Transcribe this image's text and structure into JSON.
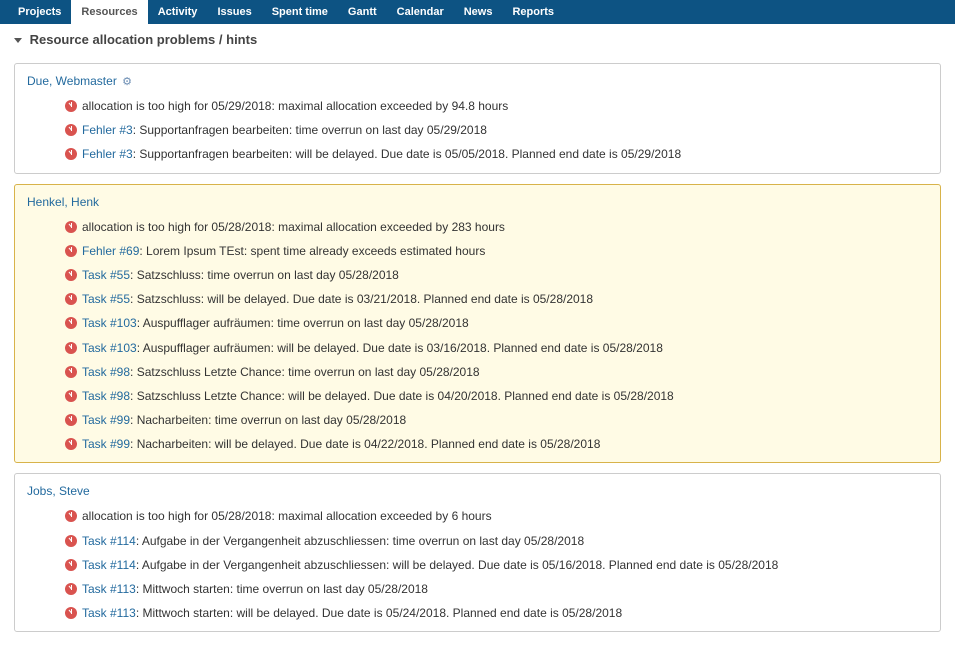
{
  "nav": [
    {
      "label": "Projects",
      "active": false
    },
    {
      "label": "Resources",
      "active": true
    },
    {
      "label": "Activity",
      "active": false
    },
    {
      "label": "Issues",
      "active": false
    },
    {
      "label": "Spent time",
      "active": false
    },
    {
      "label": "Gantt",
      "active": false
    },
    {
      "label": "Calendar",
      "active": false
    },
    {
      "label": "News",
      "active": false
    },
    {
      "label": "Reports",
      "active": false
    }
  ],
  "section_title": "Resource allocation problems / hints",
  "people": [
    {
      "name": "Due, Webmaster",
      "gear": true,
      "highlighted": false,
      "items": [
        {
          "link": "",
          "msg": "allocation is too high for 05/29/2018: maximal allocation exceeded by 94.8 hours"
        },
        {
          "link": "Fehler #3",
          "msg": "Supportanfragen bearbeiten: time overrun on last day 05/29/2018"
        },
        {
          "link": "Fehler #3",
          "msg": "Supportanfragen bearbeiten: will be delayed. Due date is 05/05/2018. Planned end date is 05/29/2018"
        }
      ]
    },
    {
      "name": "Henkel, Henk",
      "gear": false,
      "highlighted": true,
      "items": [
        {
          "link": "",
          "msg": "allocation is too high for 05/28/2018: maximal allocation exceeded by 283 hours"
        },
        {
          "link": "Fehler #69",
          "msg": "Lorem Ipsum TEst: spent time already exceeds estimated hours"
        },
        {
          "link": "Task #55",
          "msg": "Satzschluss: time overrun on last day 05/28/2018"
        },
        {
          "link": "Task #55",
          "msg": "Satzschluss: will be delayed. Due date is 03/21/2018. Planned end date is 05/28/2018"
        },
        {
          "link": "Task #103",
          "msg": "Auspufflager aufräumen: time overrun on last day 05/28/2018"
        },
        {
          "link": "Task #103",
          "msg": "Auspufflager aufräumen: will be delayed. Due date is 03/16/2018. Planned end date is 05/28/2018"
        },
        {
          "link": "Task #98",
          "msg": "Satzschluss Letzte Chance: time overrun on last day 05/28/2018"
        },
        {
          "link": "Task #98",
          "msg": "Satzschluss Letzte Chance: will be delayed. Due date is 04/20/2018. Planned end date is 05/28/2018"
        },
        {
          "link": "Task #99",
          "msg": "Nacharbeiten: time overrun on last day 05/28/2018"
        },
        {
          "link": "Task #99",
          "msg": "Nacharbeiten: will be delayed. Due date is 04/22/2018. Planned end date is 05/28/2018"
        }
      ]
    },
    {
      "name": "Jobs, Steve",
      "gear": false,
      "highlighted": false,
      "items": [
        {
          "link": "",
          "msg": "allocation is too high for 05/28/2018: maximal allocation exceeded by 6 hours"
        },
        {
          "link": "Task #114",
          "msg": "Aufgabe in der Vergangenheit abzuschliessen: time overrun on last day 05/28/2018"
        },
        {
          "link": "Task #114",
          "msg": "Aufgabe in der Vergangenheit abzuschliessen: will be delayed. Due date is 05/16/2018. Planned end date is 05/28/2018"
        },
        {
          "link": "Task #113",
          "msg": "Mittwoch starten: time overrun on last day 05/28/2018"
        },
        {
          "link": "Task #113",
          "msg": "Mittwoch starten: will be delayed. Due date is 05/24/2018. Planned end date is 05/28/2018"
        }
      ]
    }
  ]
}
